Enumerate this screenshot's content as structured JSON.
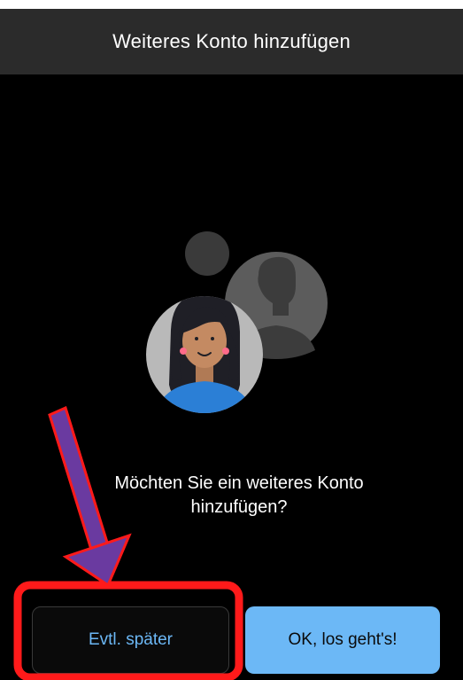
{
  "header": {
    "title": "Weiteres Konto hinzufügen"
  },
  "illustration": {
    "icon": "add-account-people-icon"
  },
  "prompt": {
    "line1": "Möchten Sie ein weiteres Konto",
    "line2": "hinzufügen?"
  },
  "buttons": {
    "later_label": "Evtl. später",
    "ok_label": "OK, los geht's!"
  },
  "colors": {
    "background": "#000000",
    "header": "#2b2b2b",
    "accent": "#6cb8f6",
    "annotation_red": "#ff1a1a",
    "annotation_purple": "#6a3aa0"
  }
}
